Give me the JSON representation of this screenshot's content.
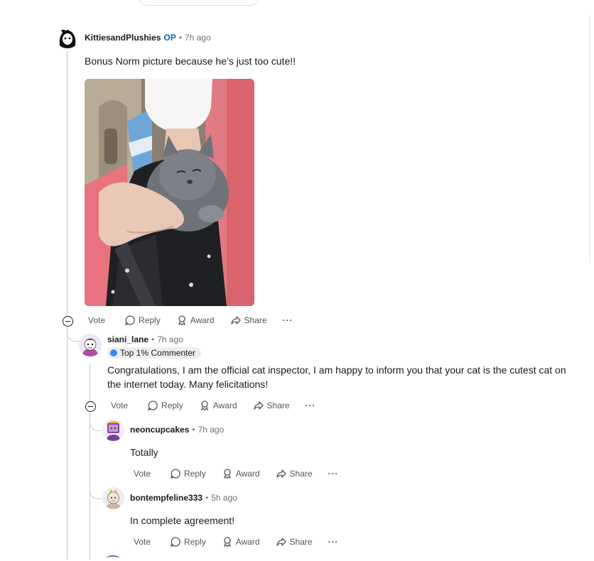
{
  "colors": {
    "op_accent": "#0a66c2",
    "flair_bg": "#eeeeee",
    "thread_line": "#c9c9c9"
  },
  "comments": [
    {
      "author": "KittiesandPlushies",
      "op_label": "OP",
      "time": "7h ago",
      "body": "Bonus Norm picture because he’s just too cute!!",
      "has_image": true,
      "actions": {
        "vote": "Vote",
        "reply": "Reply",
        "award": "Award",
        "share": "Share"
      }
    },
    {
      "author": "siani_lane",
      "time": "7h ago",
      "flair": "Top 1% Commenter",
      "body_line1": "Congratulations, I am the official cat inspector, I am happy to inform you that your cat is the cutest cat on",
      "body_line2": "the internet today. Many felicitations!",
      "actions": {
        "vote": "Vote",
        "reply": "Reply",
        "award": "Award",
        "share": "Share"
      }
    },
    {
      "author": "neoncupcakes",
      "time": "7h ago",
      "body": "Totally",
      "actions": {
        "vote": "Vote",
        "reply": "Reply",
        "award": "Award",
        "share": "Share"
      }
    },
    {
      "author": "bontempfeline333",
      "time": "5h ago",
      "body": "In complete agreement!",
      "actions": {
        "vote": "Vote",
        "reply": "Reply",
        "award": "Award",
        "share": "Share"
      }
    }
  ],
  "icons": {
    "upvote": "arrow-up-icon",
    "downvote": "arrow-down-icon",
    "reply": "chat-bubble-icon",
    "award": "award-ribbon-icon",
    "share": "share-arrow-icon",
    "more": "more-dots-icon",
    "collapse": "collapse-minus-icon"
  }
}
